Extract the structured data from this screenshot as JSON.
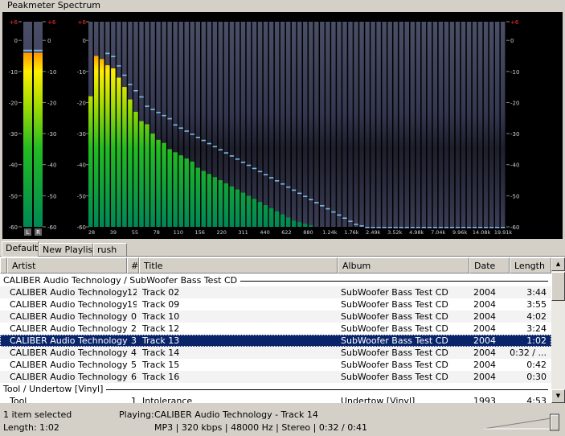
{
  "window": {
    "title": "Peakmeter Spectrum"
  },
  "peakmeter": {
    "scale_labels": [
      "+6",
      "0",
      "-10",
      "-20",
      "-30",
      "-40",
      "-50",
      "-60"
    ],
    "channels": [
      {
        "name": "L",
        "level_db": -4,
        "peak_db": -3
      },
      {
        "name": "R",
        "level_db": -4,
        "peak_db": -3
      }
    ]
  },
  "spectrum": {
    "bands_db": [
      -18,
      -5,
      -6,
      -8,
      -9,
      -12,
      -15,
      -19,
      -23,
      -26,
      -27,
      -30,
      -32,
      -33,
      -35,
      -36,
      -37,
      -38,
      -39,
      -41,
      -42,
      -43,
      -44,
      -45,
      -46,
      -47,
      -48,
      -49,
      -50,
      -51,
      -52,
      -53,
      -54,
      -55,
      -56,
      -57,
      -58,
      -58.5,
      -59,
      -59.5,
      -60,
      -60,
      -60,
      -60,
      -60,
      -60,
      -60,
      -60,
      -60,
      -60,
      -60,
      -60,
      -60,
      -60,
      -60,
      -60,
      -60,
      -60,
      -60,
      -60,
      -60,
      -60,
      -60,
      -60,
      -60,
      -60,
      -60,
      -60,
      -60,
      -60,
      -60,
      -60,
      -60,
      -60
    ],
    "peaks_db": [
      -999,
      -999,
      -999,
      -4,
      -5,
      -8,
      -11,
      -14,
      -16,
      -18,
      -21,
      -22,
      -23,
      -24,
      -25,
      -27,
      -28,
      -29,
      -30,
      -31,
      -32,
      -33,
      -34,
      -35,
      -36,
      -37,
      -38,
      -39,
      -40,
      -41,
      -42,
      -43,
      -44,
      -45,
      -46,
      -47,
      -48,
      -49,
      -50,
      -51,
      -52,
      -53,
      -54,
      -55,
      -56,
      -57,
      -58,
      -59,
      -59.5,
      -60,
      -60,
      -60,
      -60,
      -60,
      -60,
      -60,
      -60,
      -60,
      -60,
      -60,
      -60,
      -60,
      -60,
      -60,
      -60,
      -60,
      -60,
      -60,
      -60,
      -60,
      -60,
      -60,
      -60,
      -60
    ],
    "freq_labels": [
      "28",
      "39",
      "55",
      "78",
      "110",
      "156",
      "220",
      "311",
      "440",
      "622",
      "880",
      "1.24k",
      "1.76k",
      "2.49k",
      "3.52k",
      "4.98k",
      "7.04k",
      "9.96k",
      "14.08k",
      "19.91k"
    ]
  },
  "tabs": [
    {
      "label": "Default",
      "active": true
    },
    {
      "label": "New Playlist",
      "active": false
    },
    {
      "label": "rush",
      "active": false
    }
  ],
  "columns": [
    "Artist",
    "#",
    "Title",
    "Album",
    "Date",
    "Length"
  ],
  "groups": [
    {
      "label": "CALIBER Audio Technology / SubWoofer Bass Test CD"
    },
    {
      "label": "Tool / Undertow [Vinyl]"
    }
  ],
  "tracks": [
    {
      "artist": "CALIBER Audio Technology",
      "num": "12",
      "title": "Track 02",
      "album": "SubWoofer Bass Test CD",
      "date": "2004",
      "length": "3:44"
    },
    {
      "artist": "CALIBER Audio Technology",
      "num": "19",
      "title": "Track 09",
      "album": "SubWoofer Bass Test CD",
      "date": "2004",
      "length": "3:55"
    },
    {
      "artist": "CALIBER Audio Technology",
      "num": "0",
      "title": "Track 10",
      "album": "SubWoofer Bass Test CD",
      "date": "2004",
      "length": "4:02"
    },
    {
      "artist": "CALIBER Audio Technology",
      "num": "2",
      "title": "Track 12",
      "album": "SubWoofer Bass Test CD",
      "date": "2004",
      "length": "3:24"
    },
    {
      "artist": "CALIBER Audio Technology",
      "num": "3",
      "title": "Track 13",
      "album": "SubWoofer Bass Test CD",
      "date": "2004",
      "length": "1:02"
    },
    {
      "artist": "CALIBER Audio Technology",
      "num": "4",
      "title": "Track 14",
      "album": "SubWoofer Bass Test CD",
      "date": "2004",
      "length": "0:32 / ..."
    },
    {
      "artist": "CALIBER Audio Technology",
      "num": "5",
      "title": "Track 15",
      "album": "SubWoofer Bass Test CD",
      "date": "2004",
      "length": "0:42"
    },
    {
      "artist": "CALIBER Audio Technology",
      "num": "6",
      "title": "Track 16",
      "album": "SubWoofer Bass Test CD",
      "date": "2004",
      "length": "0:30"
    },
    {
      "artist": "Tool",
      "num": "1",
      "title": "Intolerance",
      "album": "Undertow [Vinyl]",
      "date": "1993",
      "length": "4:53"
    }
  ],
  "status": {
    "selection": "1 item selected",
    "length": "Length: 1:02",
    "playing_label": "Playing:",
    "playing_track": "CALIBER Audio Technology - Track 14",
    "stream_info": "MP3 | 320 kbps | 48000 Hz | Stereo | 0:32 / 0:41"
  },
  "volume": {
    "level_fraction": 0.97
  },
  "colors": {
    "selection": "#0a246a",
    "spectrum_bg": "#000000",
    "peak_marker": "#7fb8e8"
  }
}
